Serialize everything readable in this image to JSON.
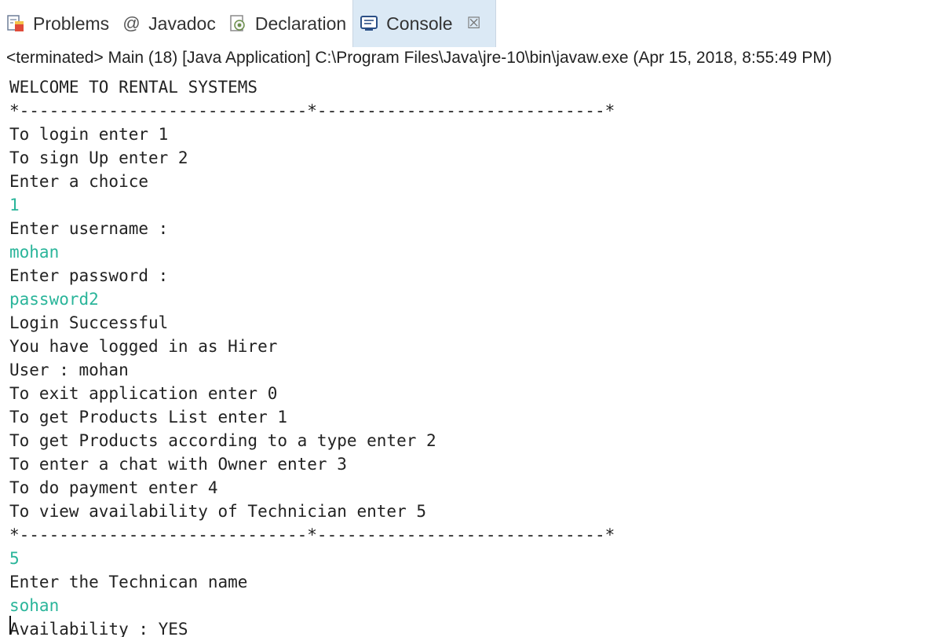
{
  "tabs": [
    {
      "label": "Problems",
      "icon": "problems-icon"
    },
    {
      "label": "Javadoc",
      "icon": "at-icon"
    },
    {
      "label": "Declaration",
      "icon": "declaration-icon"
    },
    {
      "label": "Console",
      "icon": "console-icon",
      "close": "☒"
    }
  ],
  "status_line": "<terminated> Main (18) [Java Application] C:\\Program Files\\Java\\jre-10\\bin\\javaw.exe (Apr 15, 2018, 8:55:49 PM)",
  "console": {
    "lines": [
      {
        "text": "WELCOME TO RENTAL SYSTEMS",
        "input": false
      },
      {
        "text": "*-----------------------------*-----------------------------*",
        "input": false
      },
      {
        "text": "To login enter 1",
        "input": false
      },
      {
        "text": "To sign Up enter 2",
        "input": false
      },
      {
        "text": "Enter a choice",
        "input": false
      },
      {
        "text": "1",
        "input": true
      },
      {
        "text": "Enter username :",
        "input": false
      },
      {
        "text": "mohan",
        "input": true
      },
      {
        "text": "Enter password :",
        "input": false
      },
      {
        "text": "password2",
        "input": true
      },
      {
        "text": "Login Successful",
        "input": false
      },
      {
        "text": "You have logged in as Hirer",
        "input": false
      },
      {
        "text": "User : mohan",
        "input": false
      },
      {
        "text": "To exit application enter 0",
        "input": false
      },
      {
        "text": "To get Products List enter 1",
        "input": false
      },
      {
        "text": "To get Products according to a type enter 2",
        "input": false
      },
      {
        "text": "To enter a chat with Owner enter 3",
        "input": false
      },
      {
        "text": "To do payment enter 4",
        "input": false
      },
      {
        "text": "To view availability of Technician enter 5",
        "input": false
      },
      {
        "text": "*-----------------------------*-----------------------------*",
        "input": false
      },
      {
        "text": "5",
        "input": true
      },
      {
        "text": "Enter the Technican name",
        "input": false
      },
      {
        "text": "sohan",
        "input": true
      },
      {
        "text": "Availability : YES",
        "input": false
      }
    ]
  },
  "colors": {
    "input_text": "#2ab59a",
    "active_tab_bg": "#dbe9f5"
  }
}
